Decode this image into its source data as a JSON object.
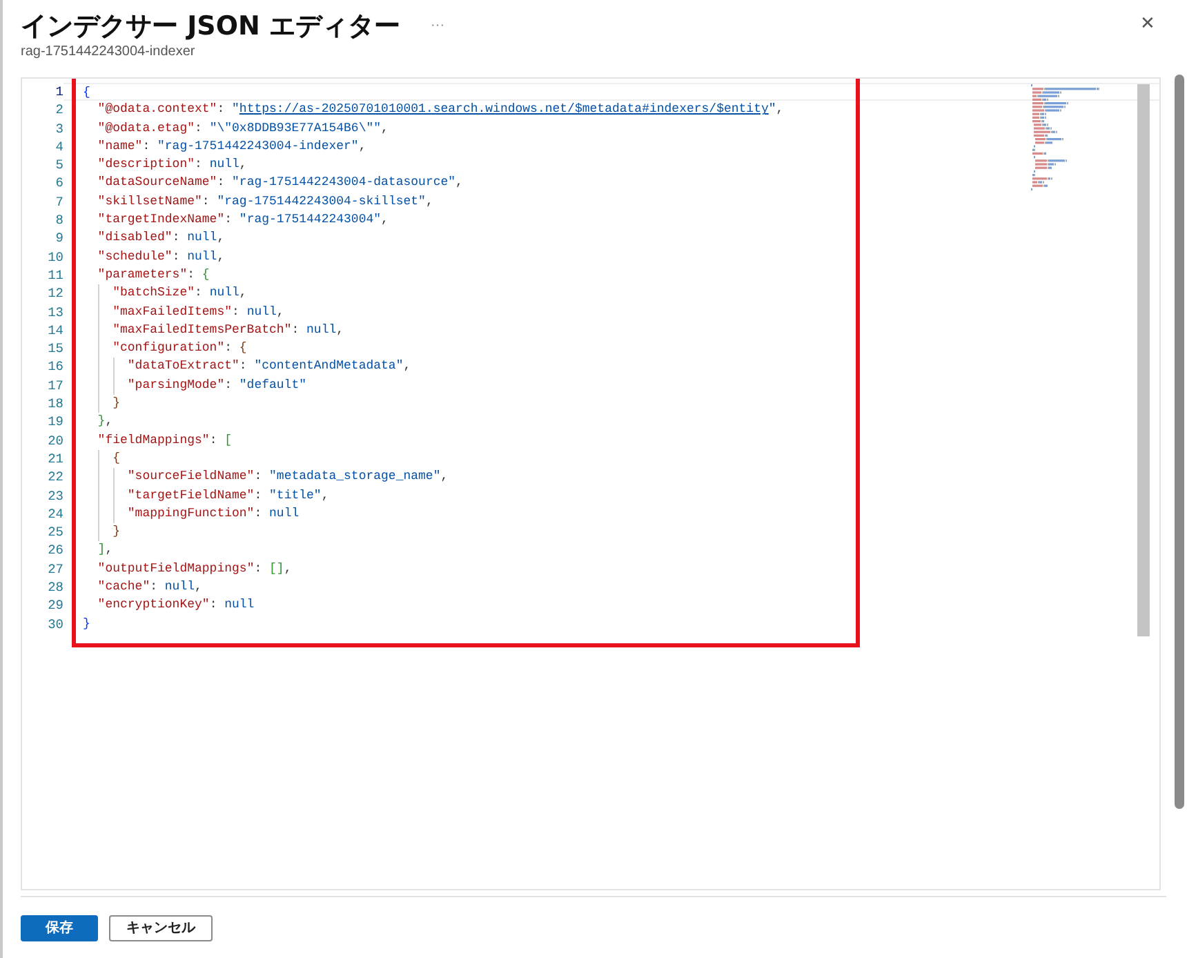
{
  "title": "インデクサー JSON エディター",
  "subtitle": "rag-1751442243004-indexer",
  "more": "···",
  "close": "✕",
  "editor": {
    "lines": [
      {
        "number": "1",
        "current": true,
        "tokens": [
          {
            "kind": "brace",
            "text": "{"
          }
        ],
        "children": [
          {
            "number": "2",
            "current": false,
            "tokens": [
              {
                "kind": "key",
                "text": "\"@odata.context\""
              },
              {
                "kind": "punct",
                "text": ":"
              },
              {
                "kind": "string",
                "text": "\""
              },
              {
                "kind": "link",
                "text": "https://as-20250701010001.search.windows.net/$metadata#indexers/$entity"
              },
              {
                "kind": "string",
                "text": "\""
              },
              {
                "kind": "punct",
                "text": ","
              }
            ]
          },
          {
            "number": "3",
            "current": false,
            "tokens": [
              {
                "kind": "key",
                "text": "\"@odata.etag\""
              },
              {
                "kind": "punct",
                "text": ":"
              },
              {
                "kind": "string",
                "text": "\"\\\"0x8DDB93E77A154B6\\\"\""
              },
              {
                "kind": "punct",
                "text": ","
              }
            ]
          },
          {
            "number": "4",
            "current": false,
            "tokens": [
              {
                "kind": "key",
                "text": "\"name\""
              },
              {
                "kind": "punct",
                "text": ":"
              },
              {
                "kind": "string",
                "text": "\"rag-1751442243004-indexer\""
              },
              {
                "kind": "punct",
                "text": ","
              }
            ]
          },
          {
            "number": "5",
            "current": false,
            "tokens": [
              {
                "kind": "key",
                "text": "\"description\""
              },
              {
                "kind": "punct",
                "text": ":"
              },
              {
                "kind": "null",
                "text": "null"
              },
              {
                "kind": "punct",
                "text": ","
              }
            ]
          },
          {
            "number": "6",
            "current": false,
            "tokens": [
              {
                "kind": "key",
                "text": "\"dataSourceName\""
              },
              {
                "kind": "punct",
                "text": ":"
              },
              {
                "kind": "string",
                "text": "\"rag-1751442243004-datasource\""
              },
              {
                "kind": "punct",
                "text": ","
              }
            ]
          },
          {
            "number": "7",
            "current": false,
            "tokens": [
              {
                "kind": "key",
                "text": "\"skillsetName\""
              },
              {
                "kind": "punct",
                "text": ":"
              },
              {
                "kind": "string",
                "text": "\"rag-1751442243004-skillset\""
              },
              {
                "kind": "punct",
                "text": ","
              }
            ]
          },
          {
            "number": "8",
            "current": false,
            "tokens": [
              {
                "kind": "key",
                "text": "\"targetIndexName\""
              },
              {
                "kind": "punct",
                "text": ":"
              },
              {
                "kind": "string",
                "text": "\"rag-1751442243004\""
              },
              {
                "kind": "punct",
                "text": ","
              }
            ]
          },
          {
            "number": "9",
            "current": false,
            "tokens": [
              {
                "kind": "key",
                "text": "\"disabled\""
              },
              {
                "kind": "punct",
                "text": ":"
              },
              {
                "kind": "null",
                "text": "null"
              },
              {
                "kind": "punct",
                "text": ","
              }
            ]
          },
          {
            "number": "10",
            "current": false,
            "tokens": [
              {
                "kind": "key",
                "text": "\"schedule\""
              },
              {
                "kind": "punct",
                "text": ":"
              },
              {
                "kind": "null",
                "text": "null"
              },
              {
                "kind": "punct",
                "text": ","
              }
            ]
          },
          {
            "number": "11",
            "current": false,
            "tokens": [
              {
                "kind": "key",
                "text": "\"parameters\""
              },
              {
                "kind": "punct",
                "text": ":"
              },
              {
                "kind": "brace2",
                "text": "{"
              }
            ],
            "children": [
              {
                "number": "12",
                "current": false,
                "tokens": [
                  {
                    "kind": "key",
                    "text": "\"batchSize\""
                  },
                  {
                    "kind": "punct",
                    "text": ":"
                  },
                  {
                    "kind": "null",
                    "text": "null"
                  },
                  {
                    "kind": "punct",
                    "text": ","
                  }
                ]
              },
              {
                "number": "13",
                "current": false,
                "tokens": [
                  {
                    "kind": "key",
                    "text": "\"maxFailedItems\""
                  },
                  {
                    "kind": "punct",
                    "text": ":"
                  },
                  {
                    "kind": "null",
                    "text": "null"
                  },
                  {
                    "kind": "punct",
                    "text": ","
                  }
                ]
              },
              {
                "number": "14",
                "current": false,
                "tokens": [
                  {
                    "kind": "key",
                    "text": "\"maxFailedItemsPerBatch\""
                  },
                  {
                    "kind": "punct",
                    "text": ":"
                  },
                  {
                    "kind": "null",
                    "text": "null"
                  },
                  {
                    "kind": "punct",
                    "text": ","
                  }
                ]
              },
              {
                "number": "15",
                "current": false,
                "tokens": [
                  {
                    "kind": "key",
                    "text": "\"configuration\""
                  },
                  {
                    "kind": "punct",
                    "text": ":"
                  },
                  {
                    "kind": "brace3",
                    "text": "{"
                  }
                ],
                "children": [
                  {
                    "number": "16",
                    "current": false,
                    "tokens": [
                      {
                        "kind": "key",
                        "text": "\"dataToExtract\""
                      },
                      {
                        "kind": "punct",
                        "text": ":"
                      },
                      {
                        "kind": "string",
                        "text": "\"contentAndMetadata\""
                      },
                      {
                        "kind": "punct",
                        "text": ","
                      }
                    ]
                  },
                  {
                    "number": "17",
                    "current": false,
                    "tokens": [
                      {
                        "kind": "key",
                        "text": "\"parsingMode\""
                      },
                      {
                        "kind": "punct",
                        "text": ":"
                      },
                      {
                        "kind": "string",
                        "text": "\"default\""
                      }
                    ]
                  }
                ]
              },
              {
                "number": "18",
                "current": false,
                "tokens": [
                  {
                    "kind": "brace3",
                    "text": "}"
                  }
                ]
              }
            ]
          },
          {
            "number": "19",
            "current": false,
            "tokens": [
              {
                "kind": "brace2",
                "text": "}"
              },
              {
                "kind": "punct",
                "text": ","
              }
            ]
          },
          {
            "number": "20",
            "current": false,
            "tokens": [
              {
                "kind": "key",
                "text": "\"fieldMappings\""
              },
              {
                "kind": "punct",
                "text": ":"
              },
              {
                "kind": "brace2",
                "text": "["
              }
            ],
            "children": [
              {
                "number": "21",
                "current": false,
                "tokens": [
                  {
                    "kind": "brace3",
                    "text": "{"
                  }
                ],
                "children": [
                  {
                    "number": "22",
                    "current": false,
                    "tokens": [
                      {
                        "kind": "key",
                        "text": "\"sourceFieldName\""
                      },
                      {
                        "kind": "punct",
                        "text": ":"
                      },
                      {
                        "kind": "string",
                        "text": "\"metadata_storage_name\""
                      },
                      {
                        "kind": "punct",
                        "text": ","
                      }
                    ]
                  },
                  {
                    "number": "23",
                    "current": false,
                    "tokens": [
                      {
                        "kind": "key",
                        "text": "\"targetFieldName\""
                      },
                      {
                        "kind": "punct",
                        "text": ":"
                      },
                      {
                        "kind": "string",
                        "text": "\"title\""
                      },
                      {
                        "kind": "punct",
                        "text": ","
                      }
                    ]
                  },
                  {
                    "number": "24",
                    "current": false,
                    "tokens": [
                      {
                        "kind": "key",
                        "text": "\"mappingFunction\""
                      },
                      {
                        "kind": "punct",
                        "text": ":"
                      },
                      {
                        "kind": "null",
                        "text": "null"
                      }
                    ]
                  }
                ]
              },
              {
                "number": "25",
                "current": false,
                "tokens": [
                  {
                    "kind": "brace3",
                    "text": "}"
                  }
                ]
              }
            ]
          },
          {
            "number": "26",
            "current": false,
            "tokens": [
              {
                "kind": "brace2",
                "text": "]"
              },
              {
                "kind": "punct",
                "text": ","
              }
            ]
          },
          {
            "number": "27",
            "current": false,
            "tokens": [
              {
                "kind": "key",
                "text": "\"outputFieldMappings\""
              },
              {
                "kind": "punct",
                "text": ":"
              },
              {
                "kind": "brace2",
                "text": "[]"
              },
              {
                "kind": "punct",
                "text": ","
              }
            ]
          },
          {
            "number": "28",
            "current": false,
            "tokens": [
              {
                "kind": "key",
                "text": "\"cache\""
              },
              {
                "kind": "punct",
                "text": ":"
              },
              {
                "kind": "null",
                "text": "null"
              },
              {
                "kind": "punct",
                "text": ","
              }
            ]
          },
          {
            "number": "29",
            "current": false,
            "tokens": [
              {
                "kind": "key",
                "text": "\"encryptionKey\""
              },
              {
                "kind": "punct",
                "text": ":"
              },
              {
                "kind": "null",
                "text": "null"
              }
            ]
          }
        ]
      },
      {
        "number": "30",
        "current": false,
        "tokens": [
          {
            "kind": "brace",
            "text": "}"
          }
        ]
      }
    ]
  },
  "buttons": [
    {
      "label": "保存",
      "kind": "primary"
    },
    {
      "label": "キャンセル",
      "kind": "secondary"
    }
  ]
}
